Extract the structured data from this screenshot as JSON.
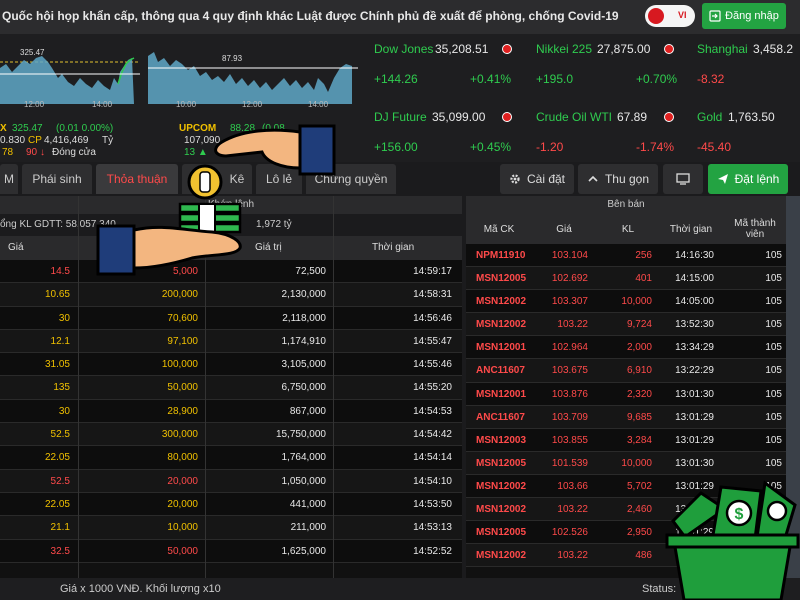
{
  "header": {
    "headline": "Quốc hội họp khẩn cấp, thông qua 4 quy định khác Luật được Chính phủ đề xuất để phòng, chống Covid-19",
    "lang_label": "VI",
    "login_label": "Đăng nhập",
    "colors": {
      "login": "#23a342",
      "toggle_knob": "#d71920"
    }
  },
  "charts": {
    "left_marker": "325.47",
    "left_times": [
      "12:00",
      "14:00"
    ],
    "mid_marker": "87.93",
    "mid_times": [
      "10:00",
      "12:00",
      "14:00"
    ]
  },
  "summary": {
    "line1_prefix": "X",
    "line1_value": "325.47",
    "line1_change": "(0.01  0.00%)",
    "line2_a": "0.830",
    "line2_b": "CP",
    "line2_c": "4,416,469",
    "line2_d": "Tỷ",
    "line3_a": "78",
    "line3_b": "90",
    "line3_c": "Đóng cửa",
    "upcom_label": "UPCOM",
    "upcom_value": "88.28",
    "upcom_change": "(0.08",
    "upcom_line2": "107,090",
    "upcom_line3": "13 ▲"
  },
  "tickers": [
    {
      "name": "Dow Jones",
      "price": "35,208.51",
      "change": "+144.26",
      "pct": "+0.41%"
    },
    {
      "name": "Nikkei 225",
      "price": "27,875.00",
      "change": "+195.0",
      "pct": "+0.70%"
    },
    {
      "name": "Shanghai",
      "price": "3,458.2",
      "change": "-8.32",
      "pct": ""
    },
    {
      "name": "DJ Future",
      "price": "35,099.00",
      "change": "+156.00",
      "pct": "+0.45%"
    },
    {
      "name": "Crude Oil WTI",
      "price": "67.89",
      "change": "-1.20",
      "pct": "-1.74%"
    },
    {
      "name": "Gold",
      "price": "1,763.50",
      "change": "-45.40",
      "pct": ""
    }
  ],
  "tabs": [
    "M",
    "Phái sinh",
    "Thỏa thuận",
    "Kê",
    "Lô lẻ",
    "Chứng quyền"
  ],
  "actions": {
    "settings": "Cài đặt",
    "collapse": "Thu gọn",
    "order": "Đặt lệnh"
  },
  "left_table": {
    "title": "Khớp lệnh",
    "summary_a": "ổng KL GDTT: 58,057,340",
    "summary_b": "1,972 tỷ",
    "headers": {
      "price": "Giá",
      "volume": "KL",
      "value": "Giá trị",
      "time": "Thời gian"
    },
    "rows": [
      {
        "price": "14.5",
        "volume": "5,000",
        "value": "72,500",
        "time": "14:59:17"
      },
      {
        "price": "10.65",
        "volume": "200,000",
        "value": "2,130,000",
        "time": "14:58:31"
      },
      {
        "price": "30",
        "volume": "70,600",
        "value": "2,118,000",
        "time": "14:56:46"
      },
      {
        "price": "12.1",
        "volume": "97,100",
        "value": "1,174,910",
        "time": "14:55:47"
      },
      {
        "price": "31.05",
        "volume": "100,000",
        "value": "3,105,000",
        "time": "14:55:46"
      },
      {
        "price": "135",
        "volume": "50,000",
        "value": "6,750,000",
        "time": "14:55:20"
      },
      {
        "price": "30",
        "volume": "28,900",
        "value": "867,000",
        "time": "14:54:53"
      },
      {
        "price": "52.5",
        "volume": "300,000",
        "value": "15,750,000",
        "time": "14:54:42"
      },
      {
        "price": "22.05",
        "volume": "80,000",
        "value": "1,764,000",
        "time": "14:54:14"
      },
      {
        "price": "52.5",
        "volume": "20,000",
        "value": "1,050,000",
        "time": "14:54:10"
      },
      {
        "price": "22.05",
        "volume": "20,000",
        "value": "441,000",
        "time": "14:53:50"
      },
      {
        "price": "21.1",
        "volume": "10,000",
        "value": "211,000",
        "time": "14:53:13"
      },
      {
        "price": "32.5",
        "volume": "50,000",
        "value": "1,625,000",
        "time": "14:52:52"
      }
    ],
    "row_price_colors": [
      "#ff4a4a",
      "#f0c000",
      "#f0c000",
      "#f0c000",
      "#f0c000",
      "#f0c000",
      "#f0c000",
      "#f0c000",
      "#f0c000",
      "#ff4a4a",
      "#f0c000",
      "#f0c000",
      "#ff4a4a"
    ]
  },
  "right_table": {
    "title": "Bên bán",
    "headers": {
      "code": "Mã CK",
      "price": "Giá",
      "volume": "KL",
      "time": "Thời gian",
      "member": "Mã thành viên"
    },
    "rows": [
      {
        "code": "NPM11910",
        "price": "103.104",
        "volume": "256",
        "time": "14:16:30",
        "member": "105"
      },
      {
        "code": "MSN12005",
        "price": "102.692",
        "volume": "401",
        "time": "14:15:00",
        "member": "105"
      },
      {
        "code": "MSN12002",
        "price": "103.307",
        "volume": "10,000",
        "time": "14:05:00",
        "member": "105"
      },
      {
        "code": "MSN12002",
        "price": "103.22",
        "volume": "9,724",
        "time": "13:52:30",
        "member": "105"
      },
      {
        "code": "MSN12001",
        "price": "102.964",
        "volume": "2,000",
        "time": "13:34:29",
        "member": "105"
      },
      {
        "code": "ANC11607",
        "price": "103.675",
        "volume": "6,910",
        "time": "13:22:29",
        "member": "105"
      },
      {
        "code": "MSN12001",
        "price": "103.876",
        "volume": "2,320",
        "time": "13:01:30",
        "member": "105"
      },
      {
        "code": "ANC11607",
        "price": "103.709",
        "volume": "9,685",
        "time": "13:01:29",
        "member": "105"
      },
      {
        "code": "MSN12003",
        "price": "103.855",
        "volume": "3,284",
        "time": "13:01:29",
        "member": "105"
      },
      {
        "code": "MSN12005",
        "price": "101.539",
        "volume": "10,000",
        "time": "13:01:30",
        "member": "105"
      },
      {
        "code": "MSN12002",
        "price": "103.66",
        "volume": "5,702",
        "time": "13:01:29",
        "member": "105"
      },
      {
        "code": "MSN12002",
        "price": "103.22",
        "volume": "2,460",
        "time": "13:01:29",
        "member": "105"
      },
      {
        "code": "MSN12005",
        "price": "102.526",
        "volume": "2,950",
        "time": "13:01:29",
        "member": "105"
      },
      {
        "code": "MSN12002",
        "price": "103.22",
        "volume": "486",
        "time": "13:01:29",
        "member": "105"
      }
    ]
  },
  "footer": {
    "note": "Giá x 1000 VNĐ. Khối lượng x10",
    "status": "Status:"
  }
}
